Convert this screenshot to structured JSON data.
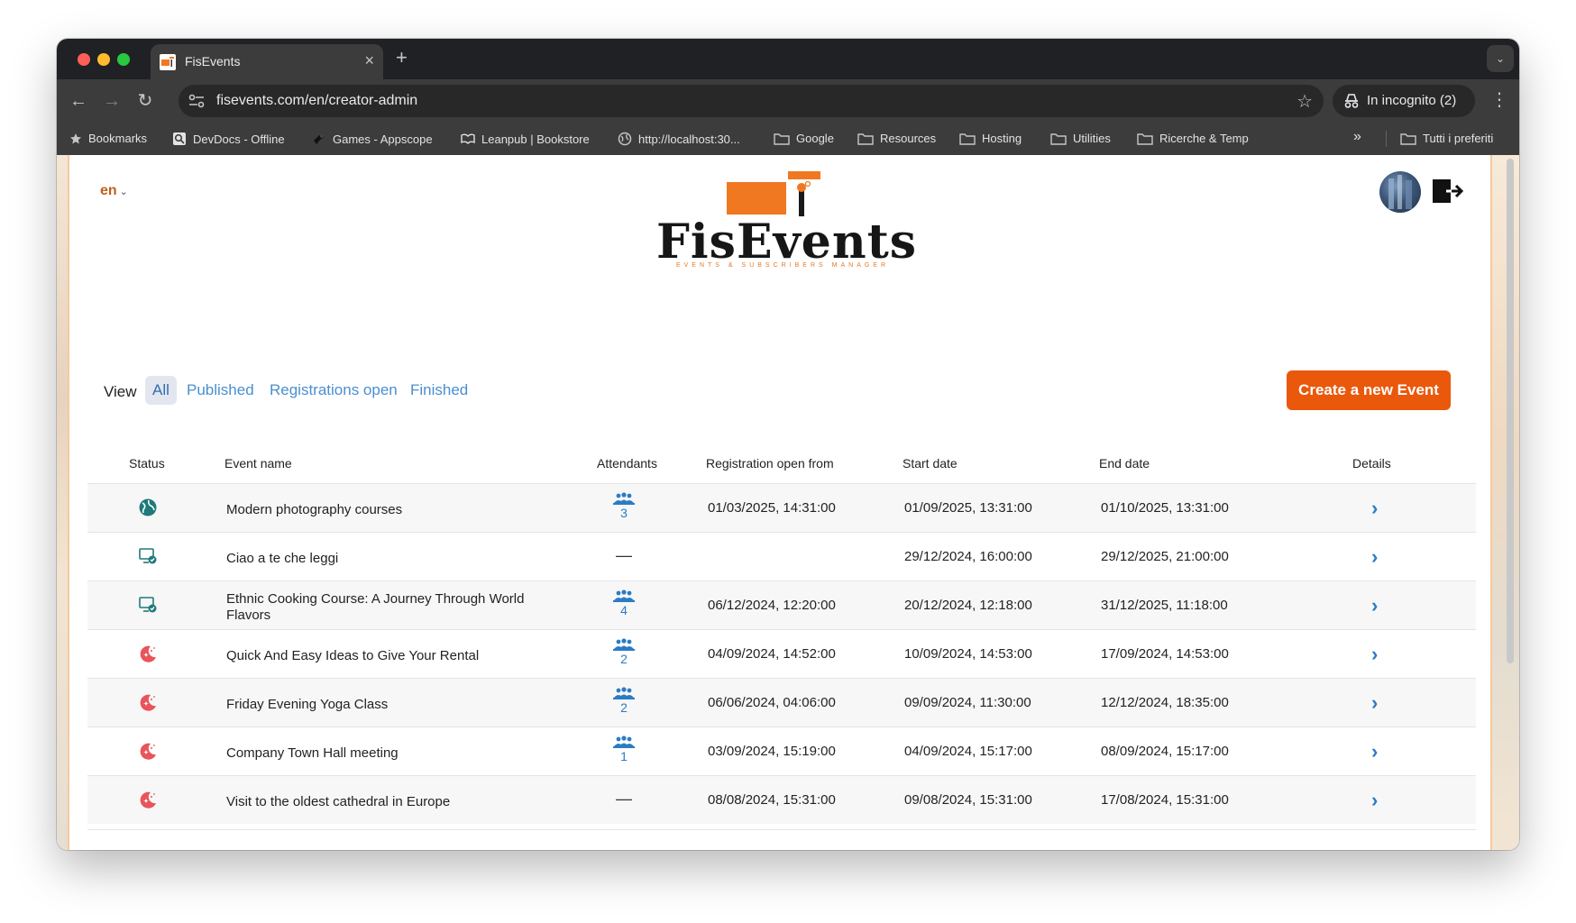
{
  "browser": {
    "tab_title": "FisEvents",
    "url": "fisevents.com/en/creator-admin",
    "incognito_label": "In incognito (2)",
    "bookmarks": [
      {
        "label": "Bookmarks",
        "icon": "star-icon"
      },
      {
        "label": "DevDocs - Offline",
        "icon": "devdocs-icon"
      },
      {
        "label": "Games - Appscope",
        "icon": "games-icon"
      },
      {
        "label": "Leanpub | Bookstore",
        "icon": "leanpub-icon"
      },
      {
        "label": "http://localhost:30...",
        "icon": "globe-icon"
      },
      {
        "label": "Google",
        "icon": "folder-icon"
      },
      {
        "label": "Resources",
        "icon": "folder-icon"
      },
      {
        "label": "Hosting",
        "icon": "folder-icon"
      },
      {
        "label": "Utilities",
        "icon": "folder-icon"
      },
      {
        "label": "Ricerche & Temp",
        "icon": "folder-icon"
      },
      {
        "label": "Tutti i preferiti",
        "icon": "folder-icon"
      }
    ],
    "overflow_label": "»"
  },
  "header": {
    "language": "en",
    "logo_text": "FisEvents",
    "logo_tagline": "EVENTS & SUBSCRIBERS MANAGER"
  },
  "filters": {
    "view_label": "View",
    "options": [
      "All",
      "Published",
      "Registrations open",
      "Finished"
    ],
    "active": "All"
  },
  "create_button_label": "Create a new Event",
  "table": {
    "columns": [
      "Status",
      "Event name",
      "Attendants",
      "Registration open from",
      "Start date",
      "End date",
      "Details"
    ],
    "rows": [
      {
        "status": "published-globe-icon",
        "name": "Modern photography courses",
        "attendants": "3",
        "registration_from": "01/03/2025, 14:31:00",
        "start": "01/09/2025, 13:31:00",
        "end": "01/10/2025, 13:31:00"
      },
      {
        "status": "online-check-icon",
        "name": "Ciao a te che leggi",
        "attendants": "—",
        "registration_from": "",
        "start": "29/12/2024, 16:00:00",
        "end": "29/12/2025, 21:00:00"
      },
      {
        "status": "online-check-icon",
        "name": "Ethnic Cooking Course: A Journey Through World Flavors",
        "attendants": "4",
        "registration_from": "06/12/2024, 12:20:00",
        "start": "20/12/2024, 12:18:00",
        "end": "31/12/2025, 11:18:00"
      },
      {
        "status": "finished-moon-icon",
        "name": "Quick And Easy Ideas to Give Your Rental",
        "attendants": "2",
        "registration_from": "04/09/2024, 14:52:00",
        "start": "10/09/2024, 14:53:00",
        "end": "17/09/2024, 14:53:00"
      },
      {
        "status": "finished-moon-icon",
        "name": "Friday Evening Yoga Class",
        "attendants": "2",
        "registration_from": "06/06/2024, 04:06:00",
        "start": "09/09/2024, 11:30:00",
        "end": "12/12/2024, 18:35:00"
      },
      {
        "status": "finished-moon-icon",
        "name": "Company Town Hall meeting",
        "attendants": "1",
        "registration_from": "03/09/2024, 15:19:00",
        "start": "04/09/2024, 15:17:00",
        "end": "08/09/2024, 15:17:00"
      },
      {
        "status": "finished-moon-icon",
        "name": "Visit to the oldest cathedral in Europe",
        "attendants": "—",
        "registration_from": "08/08/2024, 15:31:00",
        "start": "09/08/2024, 15:31:00",
        "end": "17/08/2024, 15:31:00"
      }
    ]
  },
  "colors": {
    "brand_orange": "#ea580c",
    "link_blue": "#2b7cc4",
    "finished_red": "#e8545a",
    "online_teal": "#1f7a7a"
  }
}
